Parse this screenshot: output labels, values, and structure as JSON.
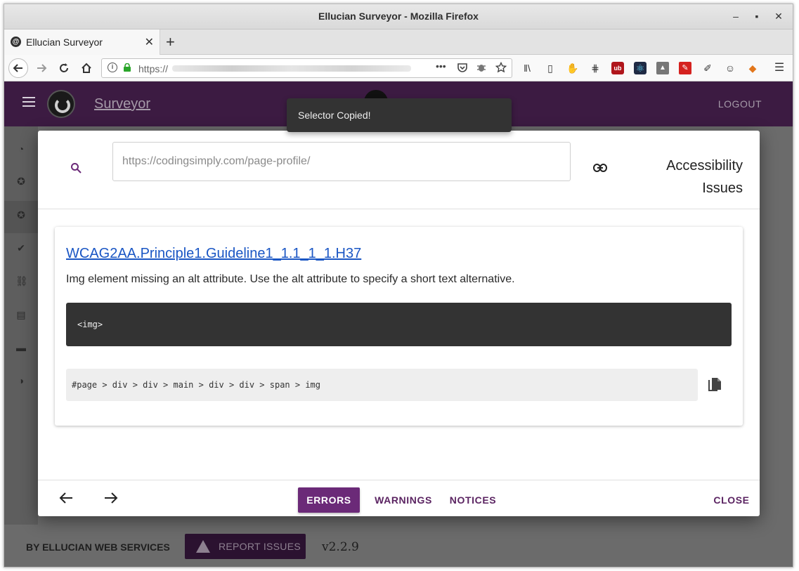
{
  "window": {
    "title": "Ellucian Surveyor - Mozilla Firefox",
    "controls": {
      "minimize": "–",
      "maximize": "▪",
      "close": "✕"
    }
  },
  "browser": {
    "tab": {
      "label": "Ellucian Surveyor",
      "close": "✕"
    },
    "new_tab": "+",
    "url_prefix": "https://",
    "page_actions": "•••"
  },
  "app": {
    "brand": "Surveyor",
    "logout": "LOGOUT",
    "footer": {
      "by": "BY ELLUCIAN WEB SERVICES",
      "report_issues": "REPORT ISSUES",
      "version": "v2.2.9"
    }
  },
  "toast": {
    "message": "Selector Copied!"
  },
  "dialog": {
    "url_value": "https://codingsimply.com/page-profile/",
    "title_line1": "Accessibility",
    "title_line2": "Issues",
    "issue": {
      "rule": "WCAG2AA.Principle1.Guideline1_1.1_1_1.H37",
      "description": "Img element missing an alt attribute. Use the alt attribute to specify a short text alternative.",
      "code": "<img>",
      "selector": "#page > div > div > main > div > div > span > img"
    },
    "footer": {
      "errors": "ERRORS",
      "warnings": "WARNINGS",
      "notices": "NOTICES",
      "close": "CLOSE"
    }
  },
  "colors": {
    "appbar": "#3c1b42",
    "accent": "#6b2a78",
    "link": "#1a56c4"
  }
}
